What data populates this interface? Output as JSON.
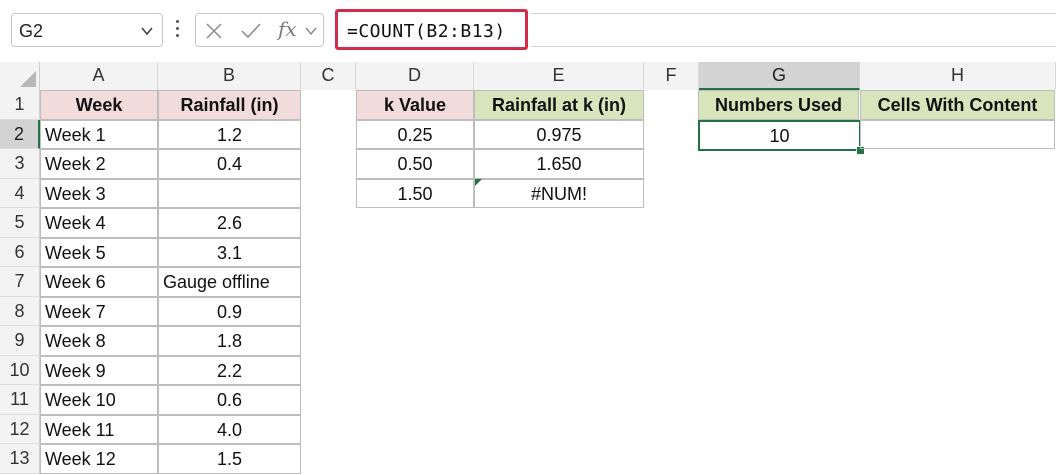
{
  "formula_bar": {
    "name_box": "G2",
    "formula": "=COUNT(B2:B13)",
    "fx_label": "fx"
  },
  "columns": [
    "A",
    "B",
    "C",
    "D",
    "E",
    "F",
    "G",
    "H"
  ],
  "rows": [
    "1",
    "2",
    "3",
    "4",
    "5",
    "6",
    "7",
    "8",
    "9",
    "10",
    "11",
    "12",
    "13"
  ],
  "table_a": {
    "headers": [
      "Week",
      "Rainfall (in)"
    ],
    "rows": [
      [
        "Week 1",
        "1.2"
      ],
      [
        "Week 2",
        "0.4"
      ],
      [
        "Week 3",
        ""
      ],
      [
        "Week 4",
        "2.6"
      ],
      [
        "Week 5",
        "3.1"
      ],
      [
        "Week 6",
        "Gauge offline"
      ],
      [
        "Week 7",
        "0.9"
      ],
      [
        "Week 8",
        "1.8"
      ],
      [
        "Week 9",
        "2.2"
      ],
      [
        "Week 10",
        "0.6"
      ],
      [
        "Week 11",
        "4.0"
      ],
      [
        "Week 12",
        "1.5"
      ]
    ]
  },
  "table_d": {
    "headers": [
      "k Value",
      "Rainfall at k (in)"
    ],
    "rows": [
      [
        "0.25",
        "0.975"
      ],
      [
        "0.50",
        "1.650"
      ],
      [
        "1.50",
        "#NUM!"
      ]
    ]
  },
  "table_g": {
    "headers": [
      "Numbers Used",
      "Cells With Content"
    ],
    "values": [
      "10",
      ""
    ]
  },
  "colors": {
    "formula_highlight": "#d22b4c",
    "header_pink": "#f2dcdb",
    "header_green": "#d8e4bc",
    "selection_green": "#217346"
  }
}
